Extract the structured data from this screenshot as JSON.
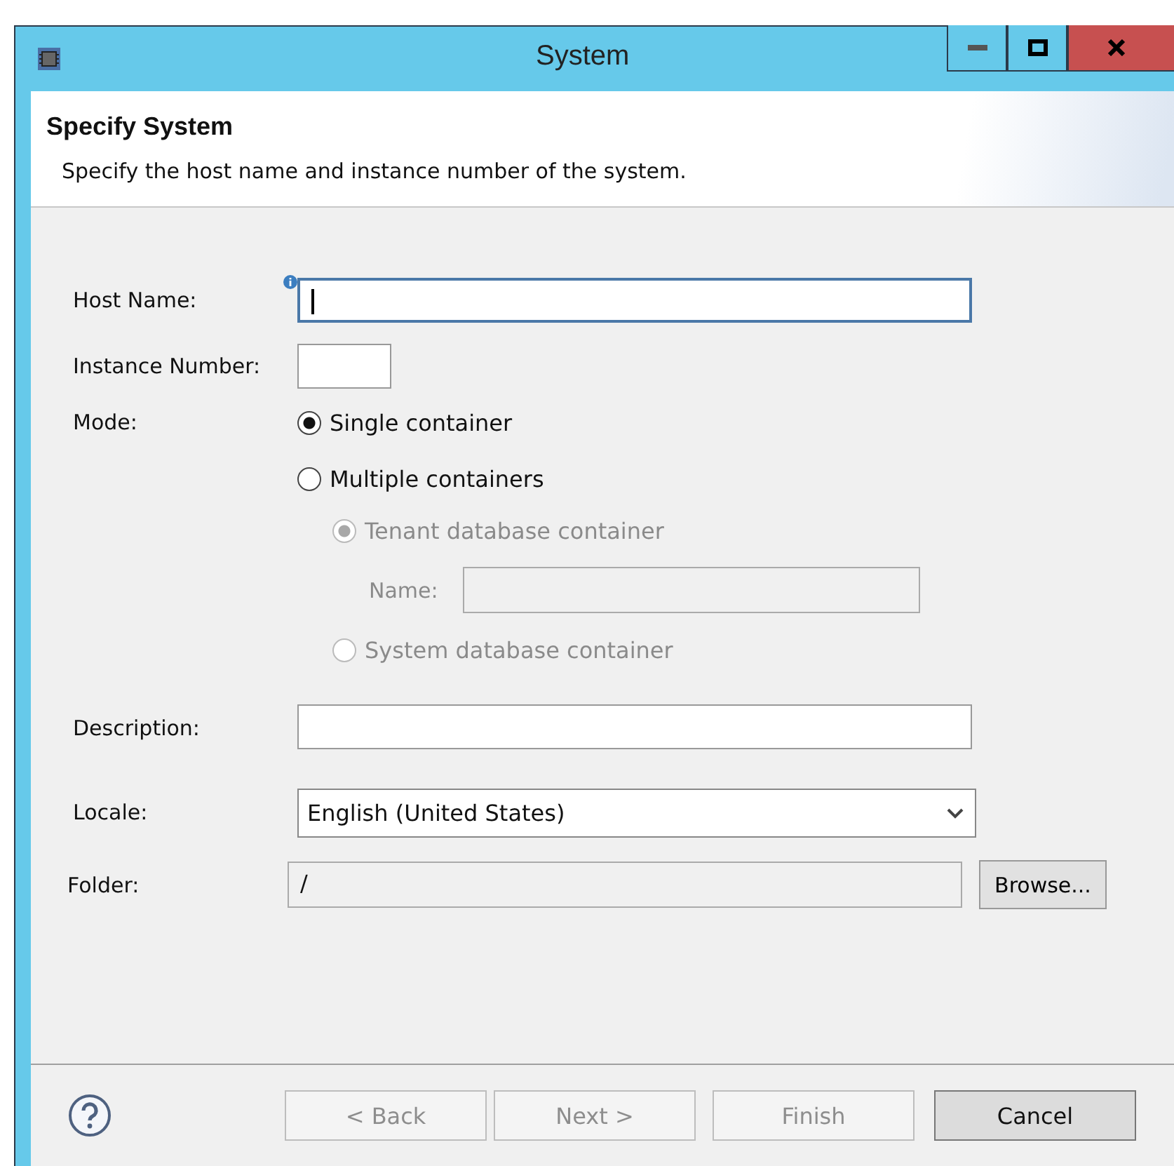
{
  "window": {
    "title": "System"
  },
  "header": {
    "title": "Specify System",
    "description": "Specify the host name and instance number of the system."
  },
  "host_name": {
    "label": "Host Name:",
    "focused": true
  },
  "instance_number": {
    "label": "Instance Number:"
  },
  "mode": {
    "label": "Mode:",
    "options": [
      {
        "label": "Single container",
        "selected": true,
        "disabled": false
      },
      {
        "label": "Multiple containers",
        "selected": false,
        "disabled": false
      }
    ],
    "sub_options": [
      {
        "label": "Tenant database container",
        "selected": true,
        "disabled": true
      },
      {
        "label": "System database container",
        "selected": false,
        "disabled": true
      }
    ],
    "name": {
      "label": "Name:",
      "disabled": true
    }
  },
  "description": {
    "label": "Description:"
  },
  "locale": {
    "label": "Locale:",
    "value": "English (United States)"
  },
  "folder": {
    "label": "Folder:",
    "value": "/",
    "disabled": true,
    "button": "Browse..."
  },
  "buttons": [
    {
      "label": "< Back",
      "disabled": true
    },
    {
      "label": "Next >",
      "disabled": true
    },
    {
      "label": "Finish",
      "disabled": true
    },
    {
      "label": "Cancel",
      "disabled": false
    }
  ]
}
